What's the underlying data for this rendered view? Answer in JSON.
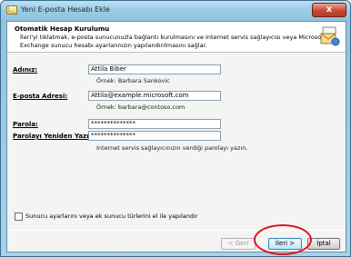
{
  "window": {
    "title": "Yeni E-posta Hesabı Ekle",
    "close_glyph": "x"
  },
  "header": {
    "title": "Otomatik Hesap Kurulumu",
    "description": "İleri'yi tıklatmak, e-posta sunucunuzla bağlantı kurulmasını ve Internet servis sağlayıcısı veya Microsoft Exchange sunucu hesabı ayarlarınızın yapılandırılmasını sağlar."
  },
  "form": {
    "name_label": "Adınız:",
    "name_value": "Attila Biber",
    "name_hint": "Örnek: Barbara Sankovic",
    "email_label": "E-posta Adresi:",
    "email_value": "Attila@example.microsoft.com",
    "email_hint": "Örnek: barbara@contoso.com",
    "password_label": "Parola:",
    "password_value": "**************",
    "retype_label": "Parolayı Yeniden Yazın:",
    "retype_value": "**************",
    "password_hint": "Internet servis sağlayıcınızın verdiği parolayı yazın."
  },
  "manual_setup": {
    "label": "Sunucu ayarlarını veya ek sunucu türlerini el ile yapılandır",
    "checked": false
  },
  "buttons": {
    "back": "< Geri",
    "next": "İleri >",
    "cancel": "İptal"
  },
  "colors": {
    "highlight": "#e0141b",
    "frame": "#8ec4e2"
  }
}
